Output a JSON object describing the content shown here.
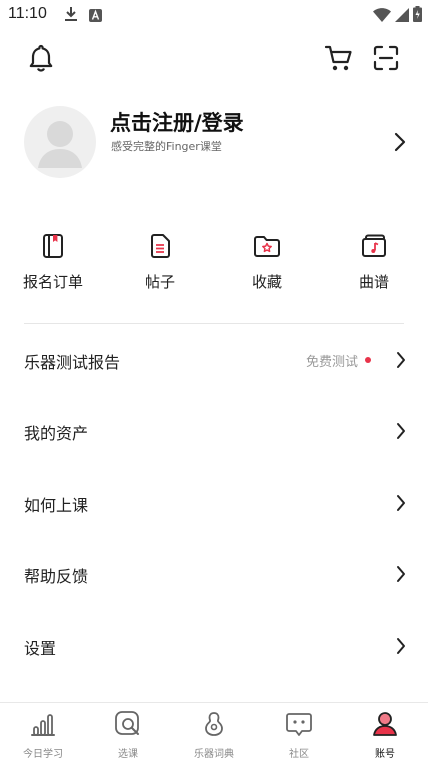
{
  "status": {
    "time": "11:10"
  },
  "profile": {
    "title": "点击注册/登录",
    "subtitle": "感受完整的Finger课堂"
  },
  "shortcuts": [
    {
      "label": "报名订单",
      "icon": "order-book-icon"
    },
    {
      "label": "帖子",
      "icon": "post-document-icon"
    },
    {
      "label": "收藏",
      "icon": "favorite-folder-icon"
    },
    {
      "label": "曲谱",
      "icon": "music-score-icon"
    }
  ],
  "menu": [
    {
      "label": "乐器测试报告",
      "extra": "免费测试"
    },
    {
      "label": "我的资产"
    },
    {
      "label": "如何上课"
    },
    {
      "label": "帮助反馈"
    },
    {
      "label": "设置"
    }
  ],
  "tabs": [
    {
      "label": "今日学习",
      "icon": "bar-chart-icon"
    },
    {
      "label": "选课",
      "icon": "search-course-icon"
    },
    {
      "label": "乐器词典",
      "icon": "guitar-icon"
    },
    {
      "label": "社区",
      "icon": "chat-bubble-icon"
    },
    {
      "label": "账号",
      "icon": "account-icon",
      "active": true
    }
  ],
  "colors": {
    "accent": "#e8334a",
    "text": "#222222",
    "muted": "#999999"
  }
}
